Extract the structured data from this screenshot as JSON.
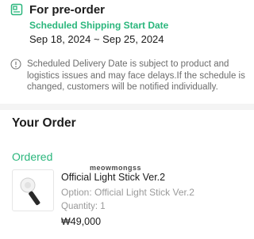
{
  "preorder": {
    "icon": "calendar-box-icon",
    "title": "For pre-order",
    "shipping_label": "Scheduled Shipping Start Date",
    "shipping_dates": "Sep 18, 2024 ~ Sep 25, 2024"
  },
  "notice": {
    "icon": "info-circle-icon",
    "text": "Scheduled Delivery Date is subject to product and logistics issues and may face delays.If the schedule is changed, customers will be notified individually."
  },
  "order": {
    "title": "Your Order",
    "status": "Ordered",
    "watermark": "meowmongss",
    "item": {
      "name": "Official Light Stick Ver.2",
      "option": "Option: Official Light Stick Ver.2",
      "quantity": "Quantity: 1",
      "price": "₩49,000",
      "thumbnail_icon": "light-stick-icon"
    }
  },
  "colors": {
    "accent": "#2ab67c",
    "muted_text": "#9a9a9a",
    "divider": "#f4f4f4"
  }
}
